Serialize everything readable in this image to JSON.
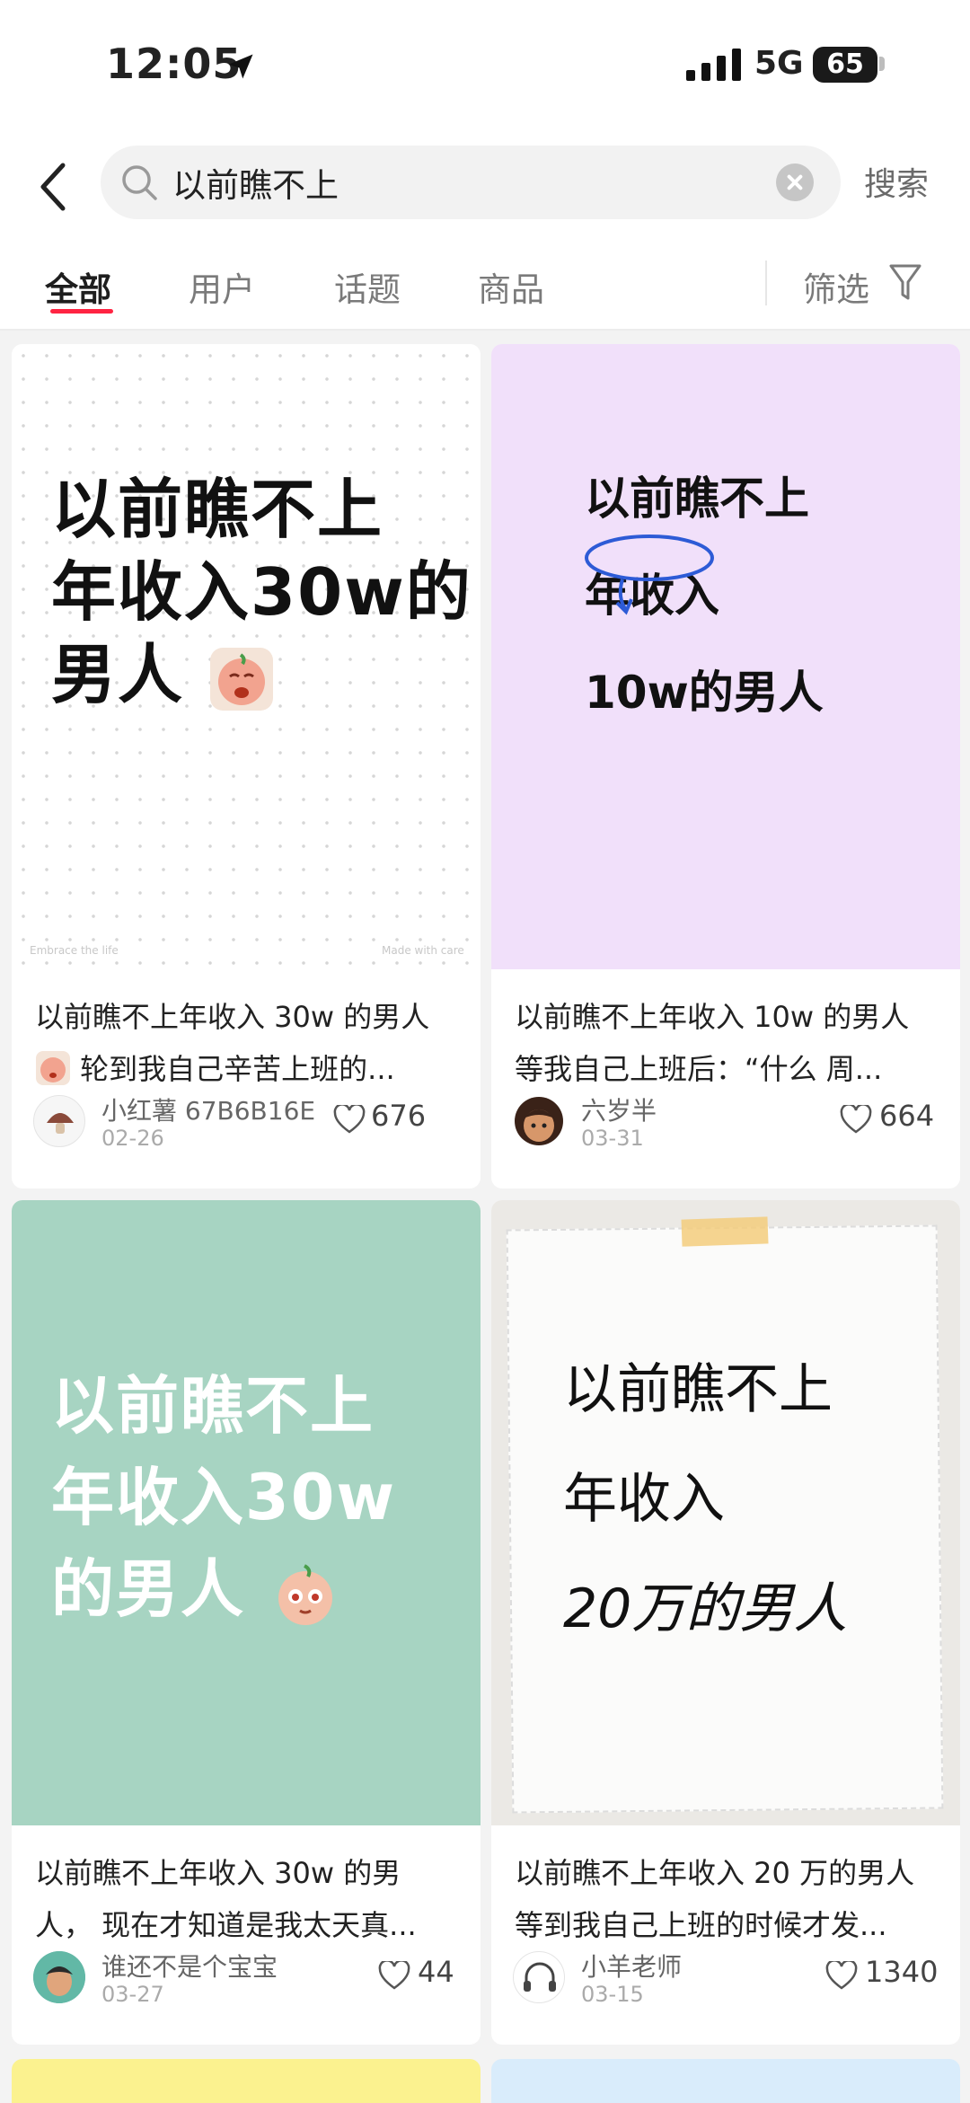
{
  "status": {
    "time": "12:05",
    "network": "5G",
    "battery": "65"
  },
  "search": {
    "query": "以前瞧不上",
    "button": "搜索"
  },
  "tabs": [
    {
      "label": "全部",
      "active": true
    },
    {
      "label": "用户",
      "active": false
    },
    {
      "label": "话题",
      "active": false
    },
    {
      "label": "商品",
      "active": false
    }
  ],
  "filter_label": "筛选",
  "cards": [
    {
      "cover_lines": [
        "以前瞧不上",
        "年收入30w的",
        "男人"
      ],
      "cover_footer_left": "Embrace the life",
      "cover_footer_right": "Made with care",
      "title_line1": "以前瞧不上年收入 30w 的男人",
      "title_line2": "轮到我自己辛苦上班的...",
      "author": "小红薯 67B6B16E",
      "date": "02-26",
      "likes": "676"
    },
    {
      "cover_lines": [
        "以前瞧不上",
        "年收入",
        "10w的男人"
      ],
      "title_line1": "以前瞧不上年收入 10w 的男人",
      "title_line2": "等我自己上班后：“什么 周...",
      "author": "六岁半",
      "date": "03-31",
      "likes": "664"
    },
    {
      "cover_lines": [
        "以前瞧不上",
        "年收入30w",
        "的男人"
      ],
      "title_line1": "以前瞧不上年收入 30w 的男",
      "title_line2": "人， 现在才知道是我太天真...",
      "author": "谁还不是个宝宝",
      "date": "03-27",
      "likes": "44"
    },
    {
      "cover_lines": [
        "以前瞧不上",
        "年收入",
        "20万的男人"
      ],
      "title_line1": "以前瞧不上年收入 20 万的男人",
      "title_line2": "等到我自己上班的时候才发...",
      "author": "小羊老师",
      "date": "03-15",
      "likes": "1340"
    }
  ],
  "colors": {
    "accent": "#ff2442",
    "cover2_bg": "#f1e0fa",
    "cover3_bg": "#a7d4c2",
    "cover4_bg": "#ebe9e5",
    "peek_left": "#fbf28f",
    "peek_right": "#d9ecfb"
  }
}
